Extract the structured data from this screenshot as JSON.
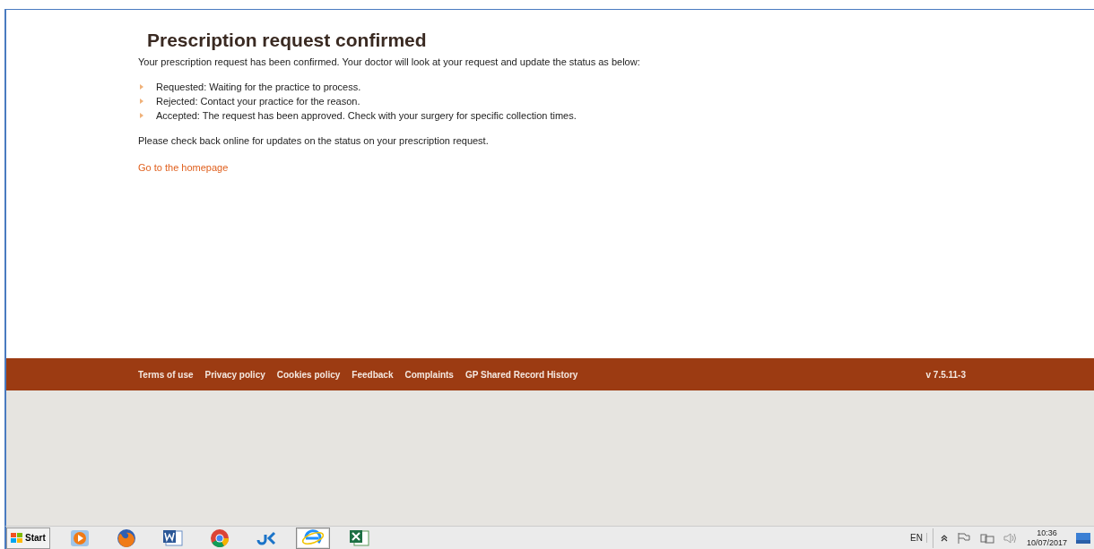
{
  "page": {
    "title": "Prescription request confirmed",
    "intro": "Your prescription request has been confirmed. Your doctor will look at your request and update the status as below:",
    "statuses": [
      "Requested: Waiting for the practice to process.",
      "Rejected: Contact your practice for the reason.",
      "Accepted: The request has been approved. Check with your surgery for specific collection times."
    ],
    "note": "Please check back online for updates on the status on your prescription request.",
    "link": "Go to the homepage"
  },
  "footer": {
    "links": [
      "Terms of use",
      "Privacy policy",
      "Cookies policy",
      "Feedback",
      "Complaints",
      "GP Shared Record History"
    ],
    "version": "v 7.5.11-3"
  },
  "taskbar": {
    "start": "Start",
    "apps": [
      {
        "kind": "media",
        "selected": false
      },
      {
        "kind": "firefox",
        "selected": false
      },
      {
        "kind": "word",
        "selected": false
      },
      {
        "kind": "chrome",
        "selected": false
      },
      {
        "kind": "app",
        "selected": false
      },
      {
        "kind": "ie",
        "selected": true
      },
      {
        "kind": "excel",
        "selected": false
      }
    ],
    "language": "EN",
    "time": "10:36",
    "date": "10/07/2017"
  }
}
